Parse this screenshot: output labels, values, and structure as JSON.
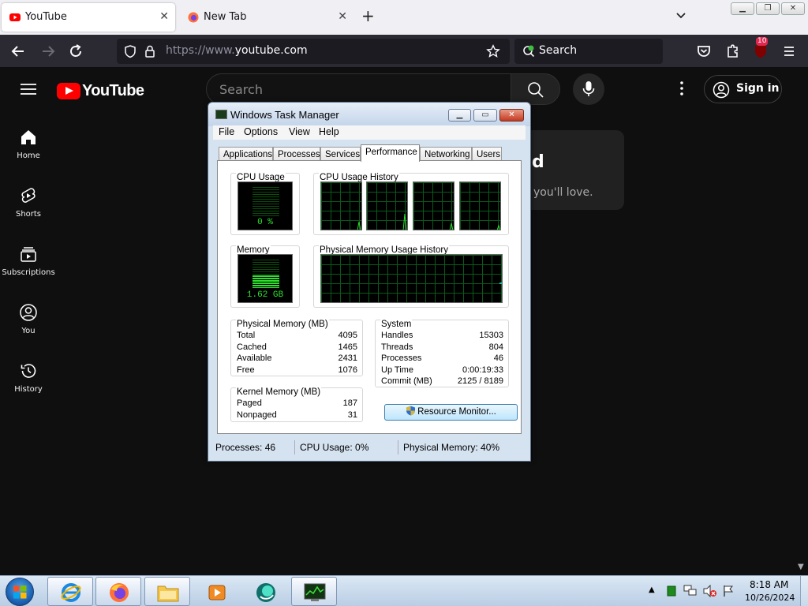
{
  "browser": {
    "tabs": [
      {
        "title": "YouTube",
        "active": true
      },
      {
        "title": "New Tab",
        "active": false
      }
    ],
    "url_protocol": "https://www.",
    "url_host": "youtube.com",
    "search_placeholder": "Search",
    "extension_badge": "10",
    "colors": {
      "tabstrip": "#f0f0f4",
      "toolbar": "#2b2a33",
      "urlbar": "#1c1b22"
    }
  },
  "youtube": {
    "logo_text": "YouTube",
    "search_placeholder": "Search",
    "sign_in": "Sign in",
    "sidebar": [
      {
        "label": "Home",
        "icon": "home-icon"
      },
      {
        "label": "Shorts",
        "icon": "shorts-icon"
      },
      {
        "label": "Subscriptions",
        "icon": "subscriptions-icon"
      },
      {
        "label": "You",
        "icon": "user-circle-icon"
      },
      {
        "label": "History",
        "icon": "history-icon"
      }
    ],
    "card_heading_fragment": "d",
    "card_text_fragment": "you'll love.",
    "colors": {
      "background": "#0f0f0f",
      "brand": "#ff0000"
    }
  },
  "task_manager": {
    "title": "Windows Task Manager",
    "menu": [
      "File",
      "Options",
      "View",
      "Help"
    ],
    "tabs": [
      "Applications",
      "Processes",
      "Services",
      "Performance",
      "Networking",
      "Users"
    ],
    "selected_tab": "Performance",
    "cpu_usage_label": "CPU Usage",
    "cpu_usage_value": "0 %",
    "cpu_history_label": "CPU Usage History",
    "memory_label": "Memory",
    "memory_value": "1.62 GB",
    "memory_history_label": "Physical Memory Usage History",
    "physical_memory": {
      "label": "Physical Memory (MB)",
      "rows": [
        {
          "k": "Total",
          "v": "4095"
        },
        {
          "k": "Cached",
          "v": "1465"
        },
        {
          "k": "Available",
          "v": "2431"
        },
        {
          "k": "Free",
          "v": "1076"
        }
      ]
    },
    "kernel_memory": {
      "label": "Kernel Memory (MB)",
      "rows": [
        {
          "k": "Paged",
          "v": "187"
        },
        {
          "k": "Nonpaged",
          "v": "31"
        }
      ]
    },
    "system": {
      "label": "System",
      "rows": [
        {
          "k": "Handles",
          "v": "15303"
        },
        {
          "k": "Threads",
          "v": "804"
        },
        {
          "k": "Processes",
          "v": "46"
        },
        {
          "k": "Up Time",
          "v": "0:00:19:33"
        },
        {
          "k": "Commit (MB)",
          "v": "2125 / 8189"
        }
      ]
    },
    "resource_monitor_button": "Resource Monitor...",
    "status": {
      "processes": "Processes: 46",
      "cpu": "CPU Usage: 0%",
      "memory": "Physical Memory: 40%"
    },
    "graph_color": "#2fe02f"
  },
  "taskbar": {
    "apps": [
      "internet-explorer-icon",
      "firefox-icon",
      "file-explorer-icon",
      "media-player-icon",
      "app-globe-icon",
      "task-manager-icon"
    ],
    "time": "8:18 AM",
    "date": "10/26/2024"
  }
}
